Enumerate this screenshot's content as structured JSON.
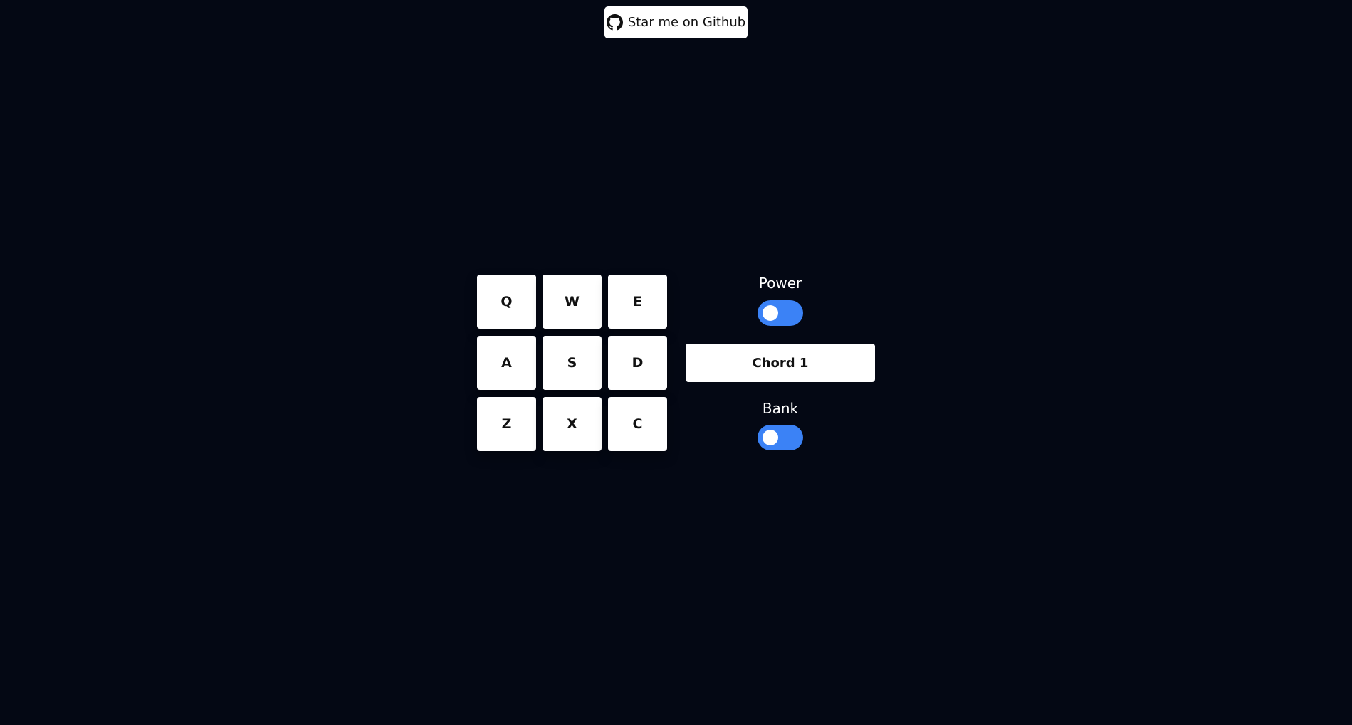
{
  "github_button": {
    "label": "Star me on Github",
    "icon": "github-icon"
  },
  "pads": [
    {
      "key": "Q"
    },
    {
      "key": "W"
    },
    {
      "key": "E"
    },
    {
      "key": "A"
    },
    {
      "key": "S"
    },
    {
      "key": "D"
    },
    {
      "key": "Z"
    },
    {
      "key": "X"
    },
    {
      "key": "C"
    }
  ],
  "controls": {
    "power": {
      "label": "Power",
      "on": true
    },
    "display": "Chord 1",
    "bank": {
      "label": "Bank",
      "on": true
    }
  },
  "colors": {
    "background": "#040814",
    "accent": "#3b82f6",
    "pad": "#ffffff"
  }
}
